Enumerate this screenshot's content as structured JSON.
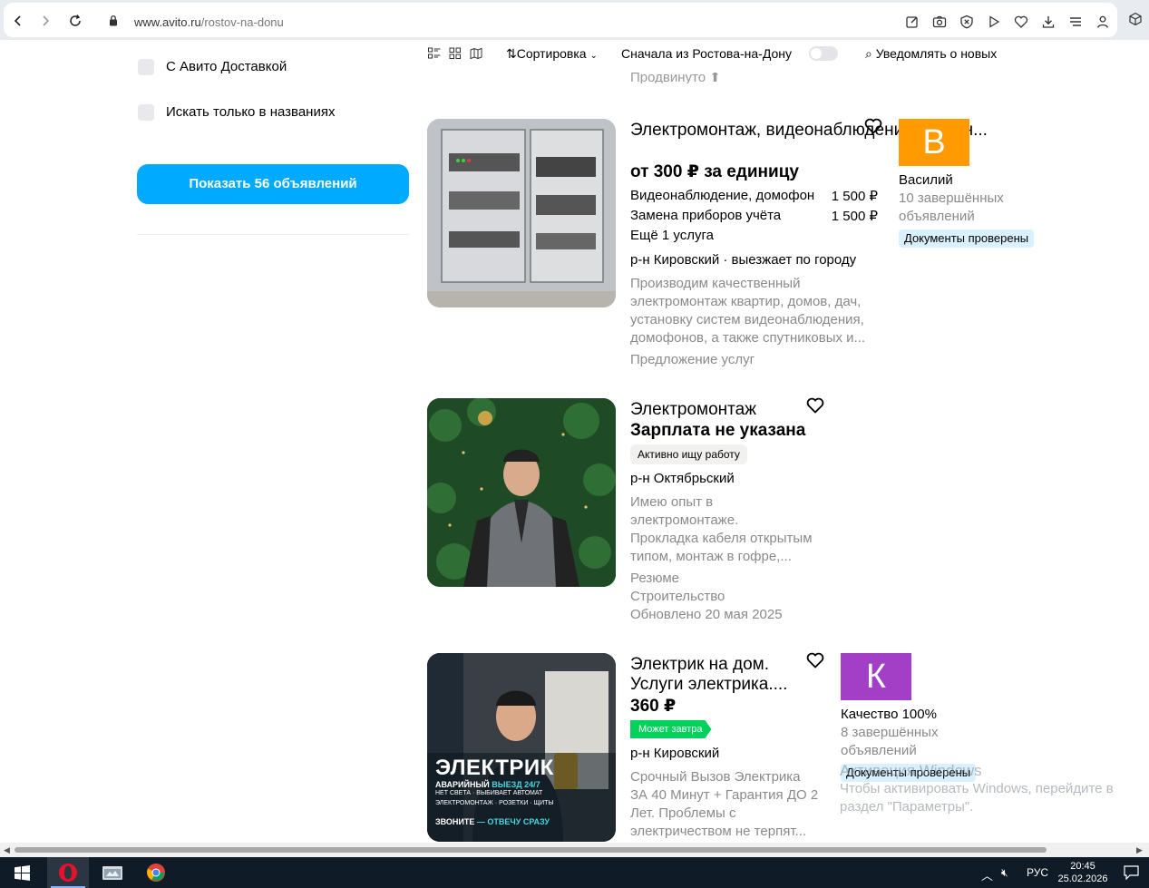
{
  "browser": {
    "url_host": "www.avito.ru",
    "url_path": "/rostov-na-donu"
  },
  "sidebar": {
    "filter_delivery": "С Авито Доставкой",
    "filter_titles_only": "Искать только в названиях",
    "show_button": "Показать 56 объявлений"
  },
  "toolbar": {
    "sort_label": "Сортировка",
    "rostov_first": "Сначала из Ростова-на-Дону",
    "notify": "Уведомлять о новых"
  },
  "cut_text": "Продвинуто",
  "listings": [
    {
      "title": "Электромонтаж, видеонаблюдение,антенн...",
      "price": "от 300 ₽ за единицу",
      "services": [
        {
          "name": "Видеонаблюдение, домофон",
          "price": "1 500 ₽"
        },
        {
          "name": "Замена приборов учёта",
          "price": "1 500 ₽"
        }
      ],
      "more_services": "Ещё 1 услуга",
      "location": "р-н Кировский · выезжает по городу",
      "description": [
        "Производим качественный",
        "электромонтаж квартир, домов, дач,",
        "установку систем видеонаблюдения,",
        "домофонов, а также спутниковых и..."
      ],
      "category": "Предложение услуг",
      "seller": {
        "initial": "В",
        "name": "Василий",
        "sub": [
          "10 завершённых",
          "объявлений"
        ],
        "badge": "Документы проверены",
        "color": "#ff9b00"
      }
    },
    {
      "title": "Электромонтаж",
      "price": "Зарплата не указана",
      "badge": "Активно ищу работу",
      "location": "р-н Октябрьский",
      "description": [
        "Имею опыт в",
        "электромонтаже.",
        "Прокладка кабеля открытым",
        "типом, монтаж в гофре,..."
      ],
      "meta": [
        "Резюме",
        "Строительство",
        "Обновлено 20 мая 2025"
      ]
    },
    {
      "title": [
        "Электрик на дом.",
        "Услуги электрика...."
      ],
      "price": "360 ₽",
      "badge": "Может завтра",
      "location": "р-н Кировский",
      "description": [
        "Срочный Вызов Электрика",
        "ЗА 40 Минут + Гарантия ДО 2",
        "Лет. Проблемы с",
        "электричеством не терпят..."
      ],
      "seller": {
        "initial": "К",
        "name": "Качество 100%",
        "sub": [
          "8 завершённых",
          "объявлений"
        ],
        "badge": "Документы проверены",
        "color": "#a33ec6"
      },
      "image_text": {
        "headline": "ЭЛЕКТРИК",
        "line1a": "АВАРИЙНЫЙ",
        "line1b": "ВЫЕЗД 24/7",
        "line2": "НЕТ СВЕТА · ВЫБИВАЕТ АВТОМАТ",
        "line3": "ЭЛЕКТРОМОНТАЖ · РОЗЕТКИ · ЩИТЫ",
        "cta_a": "ЗВОНИТЕ",
        "cta_b": "— ОТВЕЧУ СРАЗУ"
      }
    }
  ],
  "watermark": {
    "title": "Активация Windows",
    "line1": "Чтобы активировать Windows, перейдите в",
    "line2": "раздел \"Параметры\"."
  },
  "taskbar": {
    "lang": "РУС",
    "time": "20:45",
    "date": "25.02.2026"
  }
}
